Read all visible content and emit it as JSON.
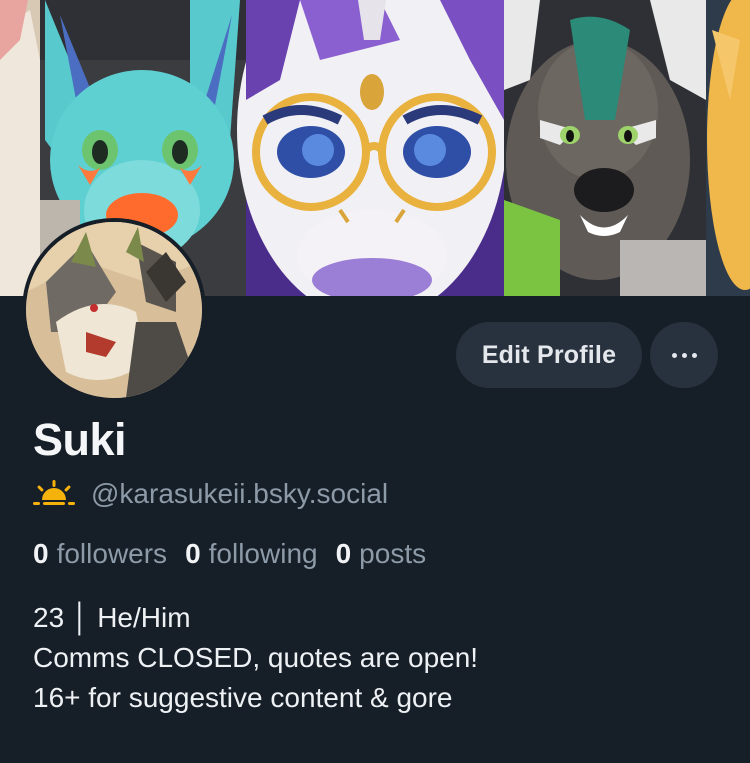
{
  "profile": {
    "display_name": "Suki",
    "handle": "@karasukeii.bsky.social",
    "handle_icon": "sunrise-icon",
    "stats": {
      "followers_count": "0",
      "followers_label": "followers",
      "following_count": "0",
      "following_label": "following",
      "posts_count": "0",
      "posts_label": "posts"
    },
    "bio": {
      "line1": "23 │ He/Him",
      "line2": "Comms CLOSED, quotes are open!",
      "line3": "16+ for suggestive content & gore"
    }
  },
  "actions": {
    "edit_profile_label": "Edit Profile",
    "more_icon": "more-horizontal-icon"
  },
  "colors": {
    "background": "#161e27",
    "button_bg": "#28323e",
    "muted_text": "#8d9aa8",
    "primary_text": "#f1f3f5",
    "icon_accent": "#f5b20b"
  }
}
